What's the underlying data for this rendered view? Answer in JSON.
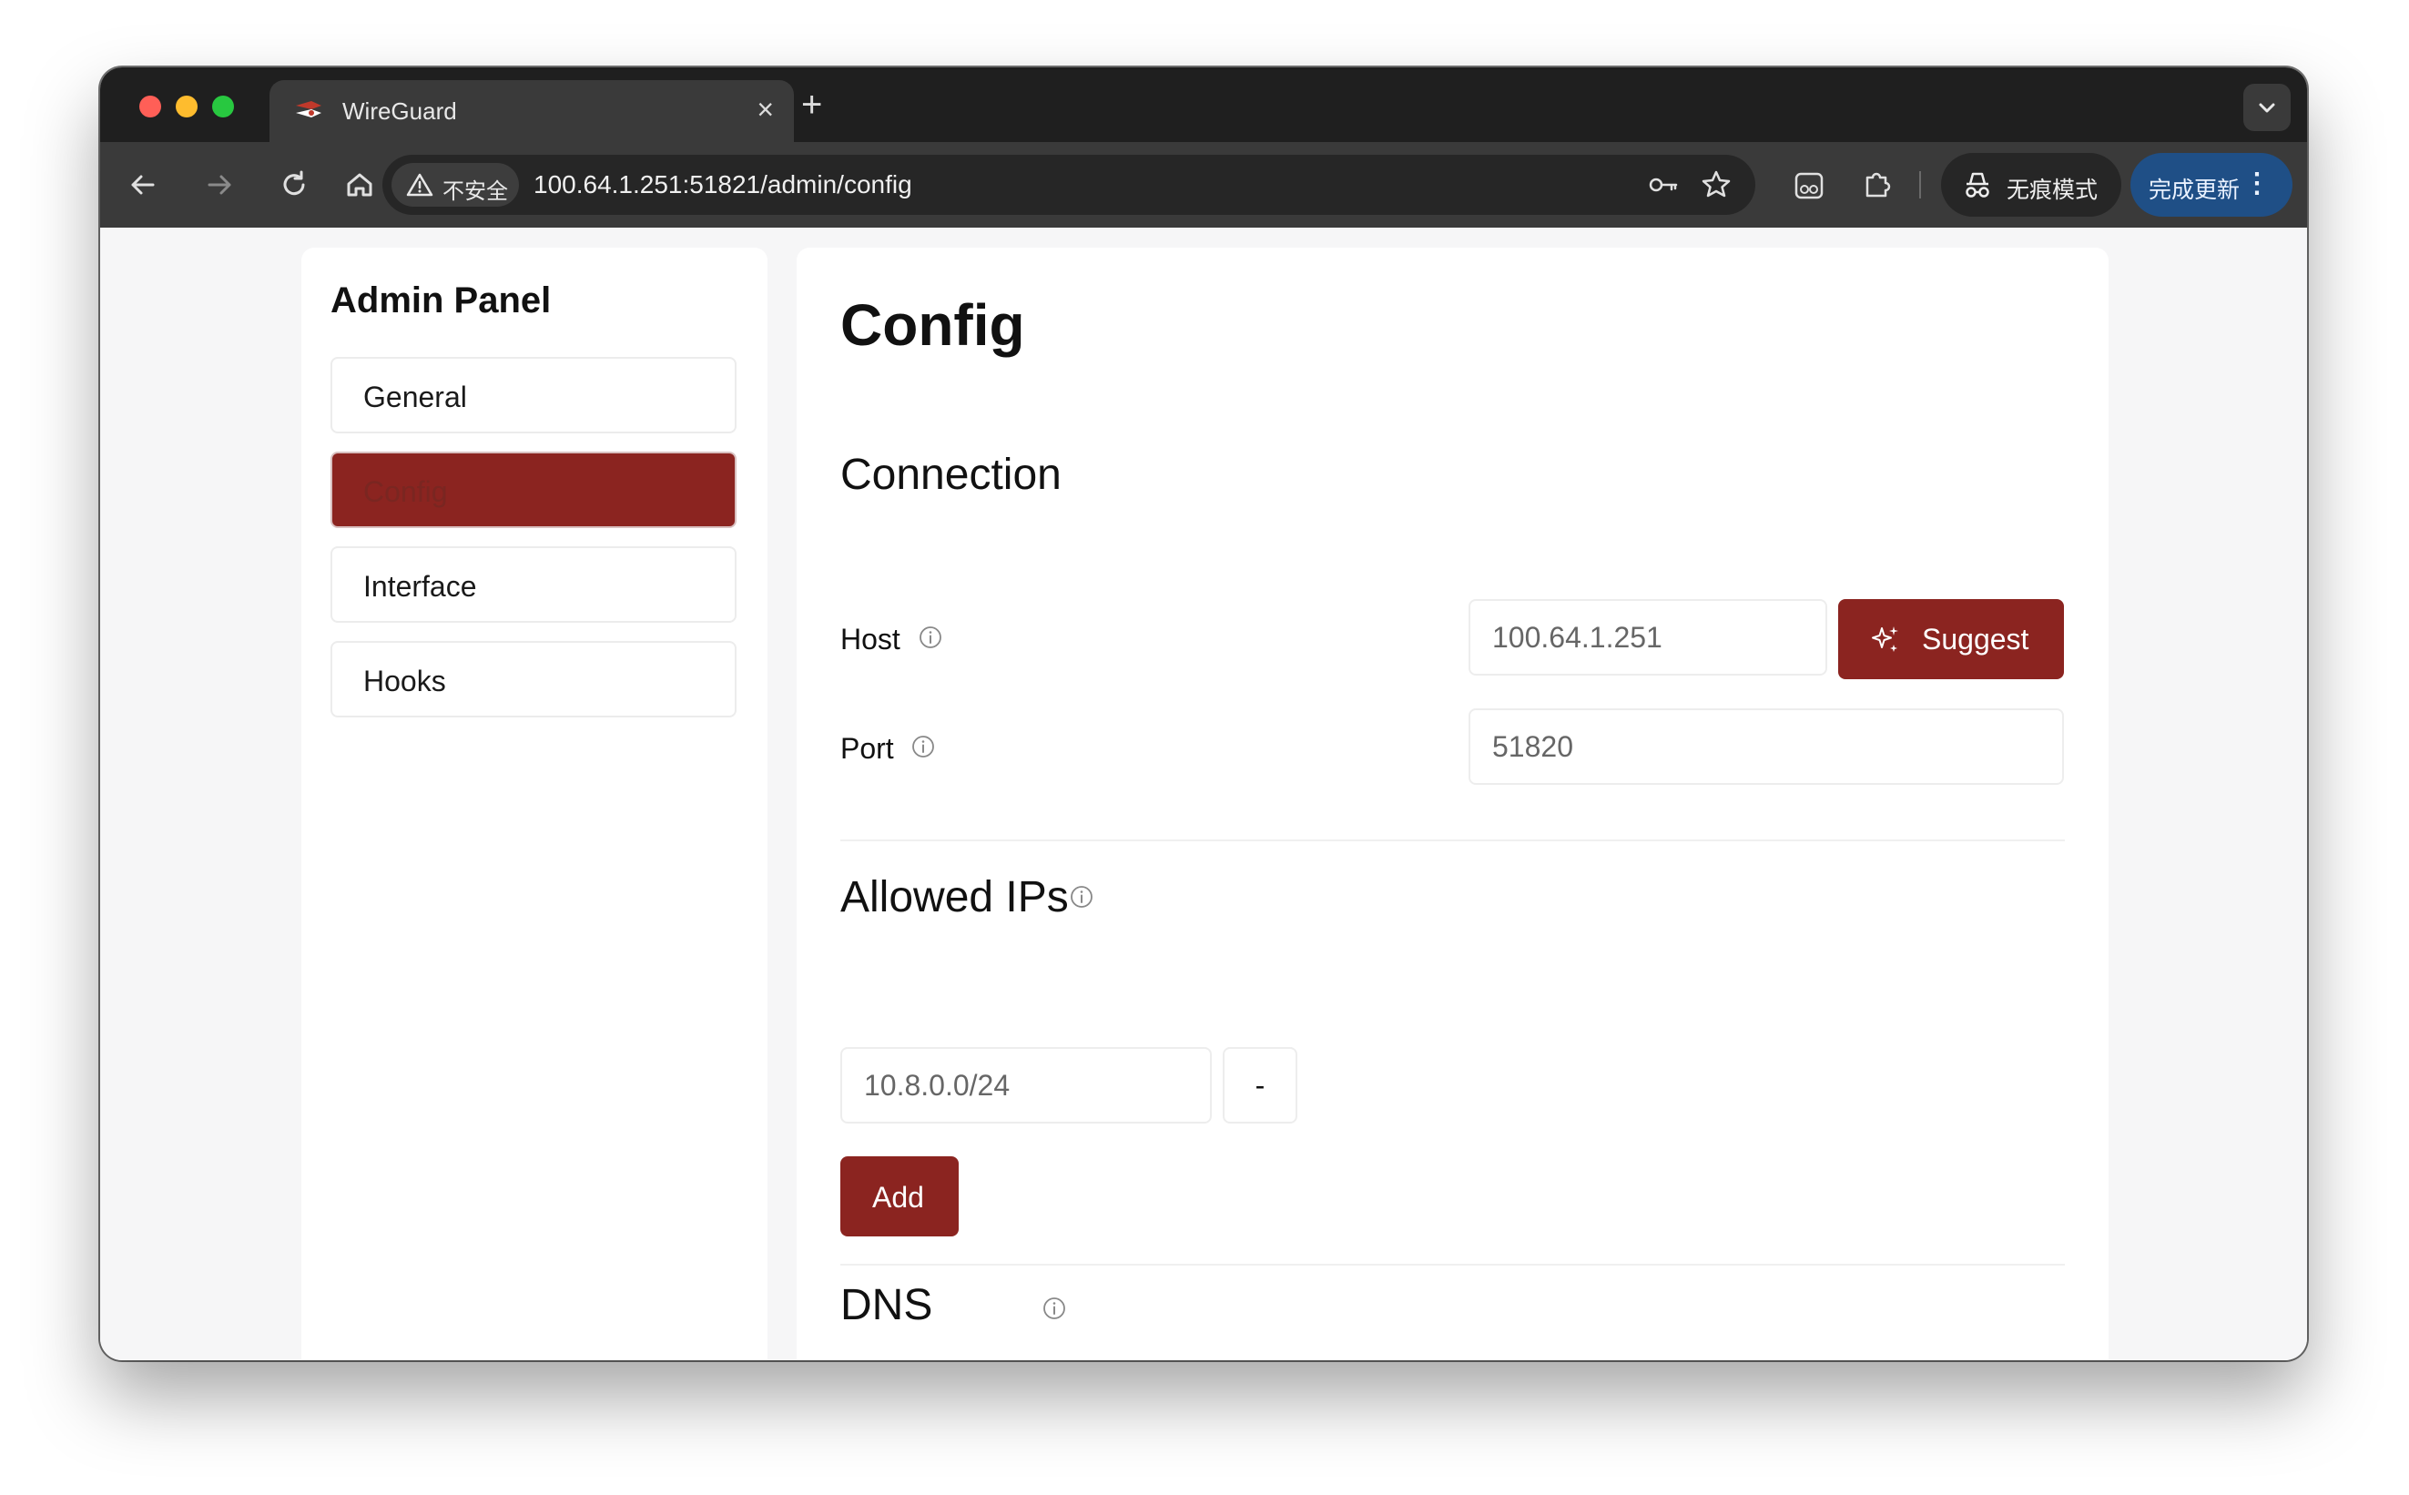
{
  "browser": {
    "tab": {
      "title": "WireGuard",
      "close": "×"
    },
    "new_tab": "+",
    "address": {
      "security_label": "不安全",
      "url": "100.64.1.251:51821/admin/config"
    },
    "incognito_label": "无痕模式",
    "update_label": "完成更新",
    "update_menu": "⋮"
  },
  "sidebar": {
    "title": "Admin Panel",
    "items": [
      {
        "label": "General",
        "active": false
      },
      {
        "label": "Config",
        "active": true
      },
      {
        "label": "Interface",
        "active": false
      },
      {
        "label": "Hooks",
        "active": false
      }
    ]
  },
  "main": {
    "title": "Config",
    "connection": {
      "title": "Connection",
      "host": {
        "label": "Host",
        "value": "100.64.1.251",
        "suggest_label": "Suggest"
      },
      "port": {
        "label": "Port",
        "value": "51820"
      }
    },
    "allowed_ips": {
      "title": "Allowed IPs",
      "entries": [
        "10.8.0.0/24"
      ],
      "remove_label": "-",
      "add_label": "Add"
    },
    "dns": {
      "title": "DNS"
    }
  },
  "colors": {
    "accent": "#8b2420",
    "tab_bar": "#1f1f1f",
    "toolbar": "#3a3a3a",
    "update_chip": "#1f4f86"
  }
}
